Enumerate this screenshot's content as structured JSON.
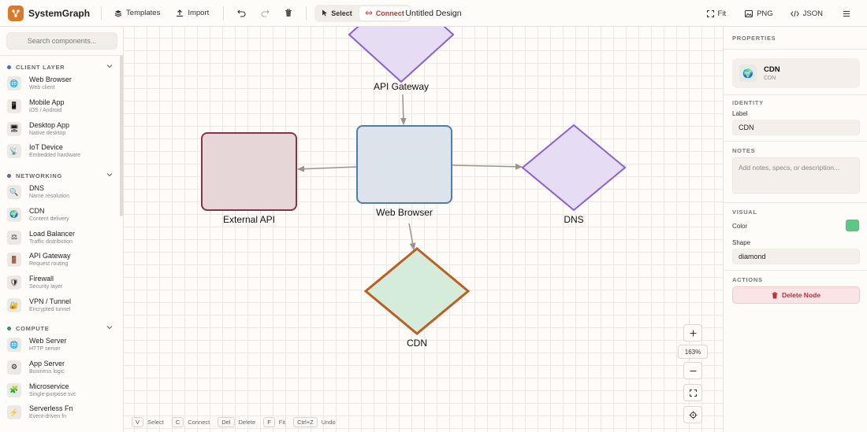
{
  "app": {
    "name": "SystemGraph",
    "document_title": "Untitled Design"
  },
  "toolbar": {
    "templates_label": "Templates",
    "import_label": "Import",
    "select_label": "Select",
    "connect_label": "Connect",
    "active_mode": "connect",
    "fit_label": "Fit",
    "png_label": "PNG",
    "json_label": "JSON"
  },
  "sidebar": {
    "search_placeholder": "Search components...",
    "sections": [
      {
        "title": "CLIENT LAYER",
        "dot_color": "#3b6fd6",
        "items": [
          {
            "label": "Web Browser",
            "sub": "Web client",
            "icon": "globe-icon",
            "glyph": "🌐"
          },
          {
            "label": "Mobile App",
            "sub": "iOS / Android",
            "icon": "mobile-icon",
            "glyph": "📱"
          },
          {
            "label": "Desktop App",
            "sub": "Native desktop",
            "icon": "desktop-icon",
            "glyph": "🖥"
          },
          {
            "label": "IoT Device",
            "sub": "Embedded hardware",
            "icon": "iot-icon",
            "glyph": "📡"
          }
        ]
      },
      {
        "title": "NETWORKING",
        "dot_color": "#7a4fd0",
        "items": [
          {
            "label": "DNS",
            "sub": "Name resolution",
            "icon": "search-icon",
            "glyph": "🔍"
          },
          {
            "label": "CDN",
            "sub": "Content delivery",
            "icon": "earth-icon",
            "glyph": "🌍"
          },
          {
            "label": "Load Balancer",
            "sub": "Traffic distribution",
            "icon": "balance-icon",
            "glyph": "⚖"
          },
          {
            "label": "API Gateway",
            "sub": "Request routing",
            "icon": "door-icon",
            "glyph": "🚪"
          },
          {
            "label": "Firewall",
            "sub": "Security layer",
            "icon": "shield-icon",
            "glyph": "🛡"
          },
          {
            "label": "VPN / Tunnel",
            "sub": "Encrypted tunnel",
            "icon": "lock-icon",
            "glyph": "🔐"
          }
        ]
      },
      {
        "title": "COMPUTE",
        "dot_color": "#2f9a55",
        "items": [
          {
            "label": "Web Server",
            "sub": "HTTP server",
            "icon": "globe-icon",
            "glyph": "🌐"
          },
          {
            "label": "App Server",
            "sub": "Business logic",
            "icon": "gear-icon",
            "glyph": "⚙"
          },
          {
            "label": "Microservice",
            "sub": "Single-purpose svc",
            "icon": "puzzle-icon",
            "glyph": "🧩"
          },
          {
            "label": "Serverless Fn",
            "sub": "Event-driven fn",
            "icon": "lightning-icon",
            "glyph": "⚡"
          }
        ]
      }
    ]
  },
  "canvas": {
    "zoom_label": "163%",
    "nodes": [
      {
        "id": "api-gateway",
        "label": "API Gateway",
        "shape": "diamond",
        "fill": "#e6dcf3",
        "stroke": "#8a5fd0"
      },
      {
        "id": "external-api",
        "label": "External API",
        "shape": "rect",
        "fill": "#e6d6d7",
        "stroke": "#843447"
      },
      {
        "id": "web-browser",
        "label": "Web Browser",
        "shape": "rect",
        "fill": "#dde3ea",
        "stroke": "#4f7dad"
      },
      {
        "id": "dns",
        "label": "DNS",
        "shape": "diamond",
        "fill": "#e6dcf3",
        "stroke": "#8a5fd0"
      },
      {
        "id": "cdn",
        "label": "CDN",
        "shape": "diamond",
        "fill": "#d4ecd9",
        "stroke": "#bb6022",
        "selected": true
      }
    ],
    "edges": [
      {
        "from": "api-gateway",
        "to": "web-browser"
      },
      {
        "from": "web-browser",
        "to": "external-api"
      },
      {
        "from": "web-browser",
        "to": "dns"
      },
      {
        "from": "web-browser",
        "to": "cdn"
      }
    ],
    "edge_color": "#9f928d",
    "shortcuts": [
      {
        "key": "V",
        "label": "Select"
      },
      {
        "key": "C",
        "label": "Connect"
      },
      {
        "key": "Del",
        "label": "Delete"
      },
      {
        "key": "F",
        "label": "Fit"
      },
      {
        "key": "Ctrl+Z",
        "label": "Undo"
      }
    ]
  },
  "properties": {
    "header": "PROPERTIES",
    "card_title": "CDN",
    "card_sub": "CDN",
    "card_icon": "earth-icon",
    "card_glyph": "🌍",
    "identity_header": "IDENTITY",
    "label_field_label": "Label",
    "label_value": "CDN",
    "notes_header": "NOTES",
    "notes_placeholder": "Add notes, specs, or description...",
    "visual_header": "VISUAL",
    "color_label": "Color",
    "color_value": "#5cc883",
    "shape_label": "Shape",
    "shape_value": "diamond",
    "actions_header": "ACTIONS",
    "delete_label": "Delete Node"
  }
}
